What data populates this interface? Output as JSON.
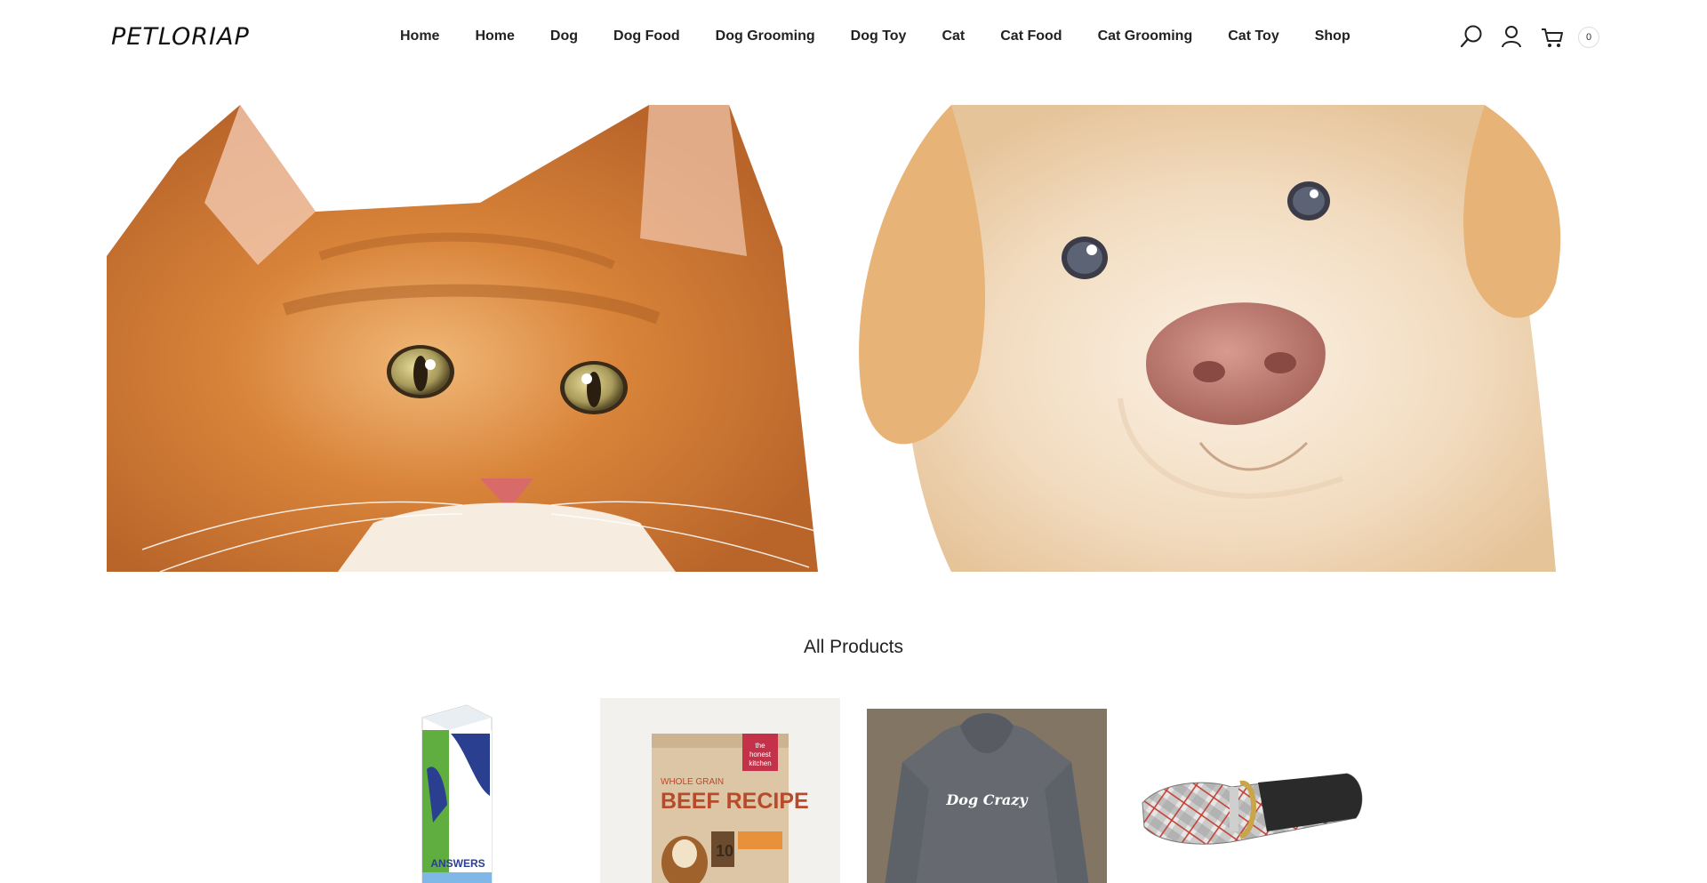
{
  "brand": {
    "logo_text": "PETLORIAP"
  },
  "nav": {
    "items": [
      {
        "label": "Home"
      },
      {
        "label": "Home"
      },
      {
        "label": "Dog"
      },
      {
        "label": "Dog Food"
      },
      {
        "label": "Dog Grooming"
      },
      {
        "label": "Dog Toy"
      },
      {
        "label": "Cat"
      },
      {
        "label": "Cat Food"
      },
      {
        "label": "Cat Grooming"
      },
      {
        "label": "Cat Toy"
      },
      {
        "label": "Shop"
      }
    ]
  },
  "header_icons": {
    "search": "search-icon",
    "account": "user-icon",
    "cart": "cart-icon",
    "cart_count": "0"
  },
  "hero": {
    "left_image": "kitten-photo",
    "right_image": "puppy-photo"
  },
  "section": {
    "title": "All Products"
  },
  "products": [
    {
      "image": "answers-carton-photo",
      "carton_text": "ANSWERS"
    },
    {
      "image": "beef-recipe-bag-photo",
      "bag_line1": "WHOLE GRAIN",
      "bag_line2": "BEEF RECIPE",
      "brand_line1": "the",
      "brand_line2": "honest",
      "brand_line3": "kitchen"
    },
    {
      "image": "dog-crazy-hoodie-photo",
      "hoodie_text": "Dog Crazy"
    },
    {
      "image": "plaid-collar-photo"
    }
  ],
  "colors": {
    "text": "#222222",
    "kitten_orange": "#d9843a",
    "puppy_cream": "#f2dcc0",
    "hoodie_gray": "#666a70"
  }
}
